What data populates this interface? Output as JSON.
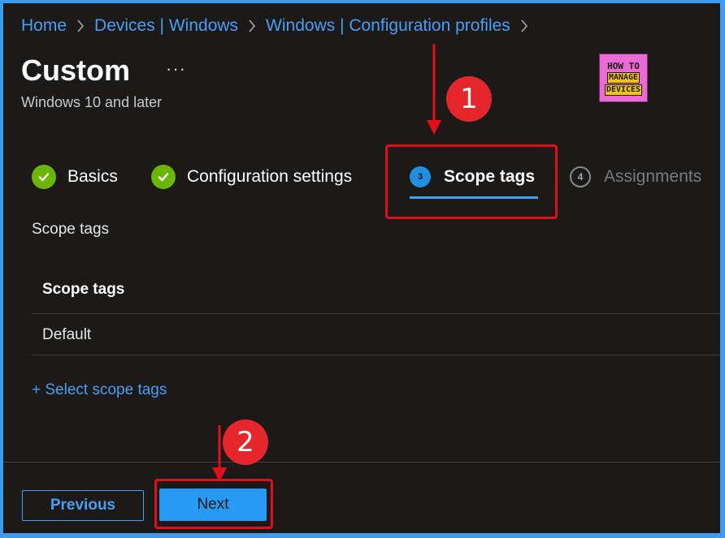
{
  "breadcrumb": {
    "items": [
      "Home",
      "Devices | Windows",
      "Windows | Configuration profiles"
    ]
  },
  "header": {
    "title": "Custom",
    "more": "···",
    "subtitle": "Windows 10 and later"
  },
  "logo": {
    "line1": "HOW TO",
    "line2": "MANAGE",
    "line3": "DEVICES"
  },
  "wizard": {
    "steps": [
      {
        "label": "Basics",
        "state": "completed"
      },
      {
        "label": "Configuration settings",
        "state": "completed"
      },
      {
        "number": "3",
        "label": "Scope tags",
        "state": "active"
      },
      {
        "number": "4",
        "label": "Assignments",
        "state": "inactive"
      }
    ]
  },
  "scope_section": {
    "label": "Scope tags",
    "table": {
      "column": "Scope tags",
      "rows": [
        "Default"
      ]
    },
    "select_link": "+ Select scope tags"
  },
  "footer": {
    "previous_label": "Previous",
    "next_label": "Next"
  },
  "annotations": {
    "callout_1": "1",
    "callout_2": "2",
    "highlight_color": "#e30e1c"
  },
  "colors": {
    "accent": "#479ef5",
    "success": "#6bb700",
    "background": "#1b1a19",
    "frame_border": "#3b9cf0"
  }
}
